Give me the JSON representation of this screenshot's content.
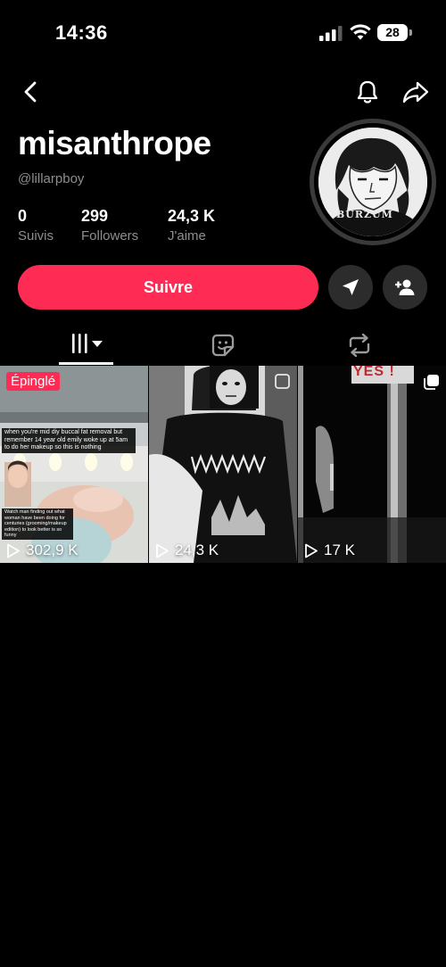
{
  "status_bar": {
    "time": "14:36",
    "battery": "28"
  },
  "profile": {
    "name": "misanthrope",
    "handle": "@lillarpboy",
    "stats": [
      {
        "value": "0",
        "label": "Suivis"
      },
      {
        "value": "299",
        "label": "Followers"
      },
      {
        "value": "24,3 K",
        "label": "J'aime"
      }
    ],
    "avatar_shirt_text": "BURZUM"
  },
  "actions": {
    "follow_label": "Suivre"
  },
  "tabs": [
    {
      "icon": "grid-icon",
      "active": true
    },
    {
      "icon": "sticker-icon",
      "active": false
    },
    {
      "icon": "repost-icon",
      "active": false
    }
  ],
  "videos": [
    {
      "views": "302,9 K",
      "badge": "Épinglé",
      "caption_1": "when you're mid diy buccal fat removal but remember 14 year old emily woke up at 5am to do her makeup so this is nothing",
      "caption_2": "Watch man finding out what woman have been doing for centuries (grooming/makeup edition) to look better is so funny"
    },
    {
      "views": "24,3 K"
    },
    {
      "views": "17 K",
      "overlay_text": "YES !"
    }
  ],
  "colors": {
    "accent": "#fe2c55",
    "background": "#000000",
    "secondary_text": "#8e8e8e",
    "button_dark": "#2c2c2c"
  }
}
